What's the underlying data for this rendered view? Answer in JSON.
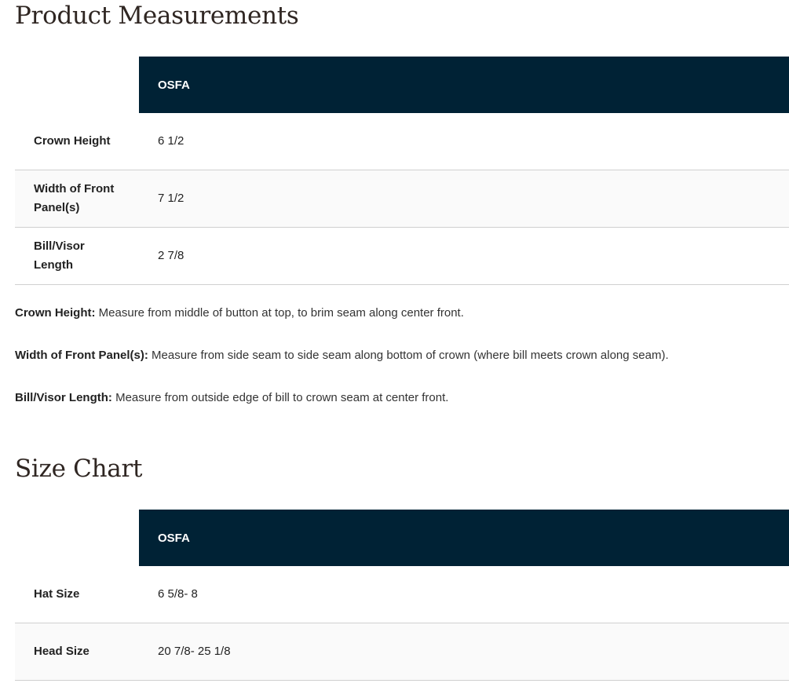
{
  "measurements": {
    "title": "Product Measurements",
    "column": "OSFA",
    "rows": [
      {
        "label": "Crown Height",
        "value": "6 1/2"
      },
      {
        "label": "Width of Front Panel(s)",
        "value": "7 1/2"
      },
      {
        "label": "Bill/Visor Length",
        "value": "2 7/8"
      }
    ],
    "notes": [
      {
        "term": "Crown Height:",
        "text": " Measure from middle of button at top, to brim seam along center front."
      },
      {
        "term": "Width of Front Panel(s):",
        "text": " Measure from side seam to side seam along bottom of crown (where bill meets crown along seam)."
      },
      {
        "term": "Bill/Visor Length:",
        "text": " Measure from outside edge of bill to crown seam at center front."
      }
    ]
  },
  "size_chart": {
    "title": "Size Chart",
    "column": "OSFA",
    "rows": [
      {
        "label": "Hat Size",
        "value": "6 5/8- 8"
      },
      {
        "label": "Head Size",
        "value": "20 7/8- 25 1/8"
      }
    ]
  }
}
